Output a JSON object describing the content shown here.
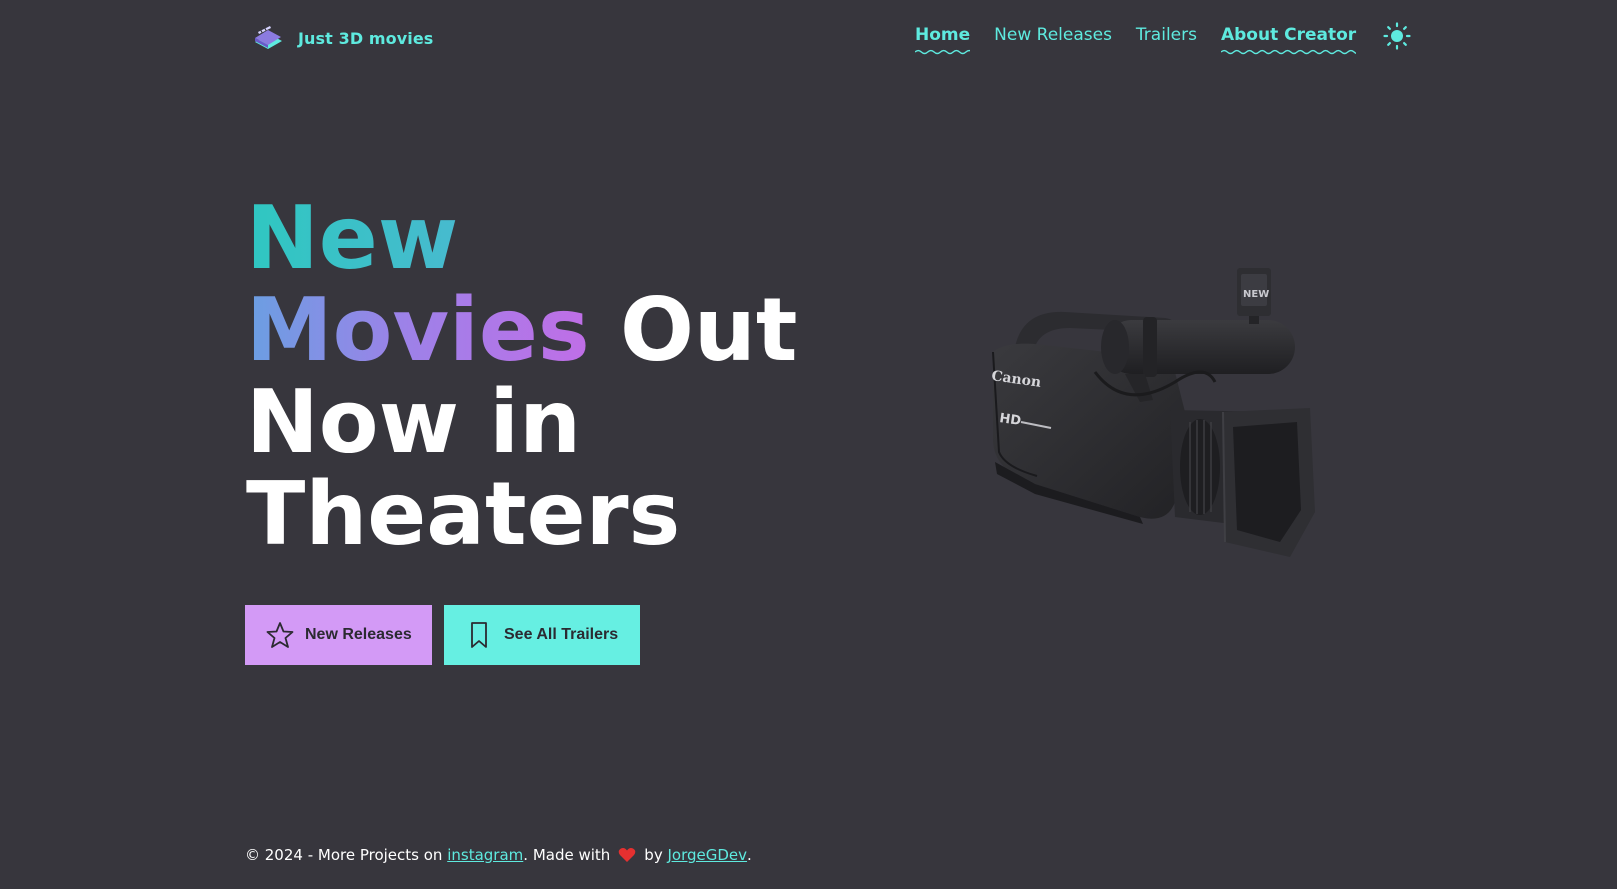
{
  "header": {
    "brand": {
      "name": "Just 3D movies",
      "logo_icon": "clapperboard-icon"
    },
    "nav": [
      {
        "label": "Home",
        "active": true
      },
      {
        "label": "New Releases",
        "active": false
      },
      {
        "label": "Trailers",
        "active": false
      },
      {
        "label": "About Creator",
        "active": true
      }
    ],
    "theme_toggle_icon": "sun-icon"
  },
  "hero": {
    "title": {
      "line1": "New",
      "line2_gradient": "Movies",
      "line2_rest": "Out",
      "line3": "Now in",
      "line4": "Theaters"
    },
    "buttons": {
      "primary": {
        "label": "New Releases",
        "icon": "star-icon"
      },
      "secondary": {
        "label": "See All Trailers",
        "icon": "bookmark-icon"
      }
    },
    "illustration": {
      "camera_brand": "Canon",
      "camera_badge": "HD"
    }
  },
  "footer": {
    "prefix": "© 2024 - More Projects on",
    "instagram_link": "instagram",
    "made_with": ". Made with",
    "by": "by",
    "author_link": "JorgeGDev",
    "suffix": "."
  },
  "colors": {
    "background": "#37363d",
    "accent_teal": "#5eeadf",
    "button_purple": "#d39af6",
    "button_teal": "#66efe2",
    "heart": "#e53030"
  }
}
